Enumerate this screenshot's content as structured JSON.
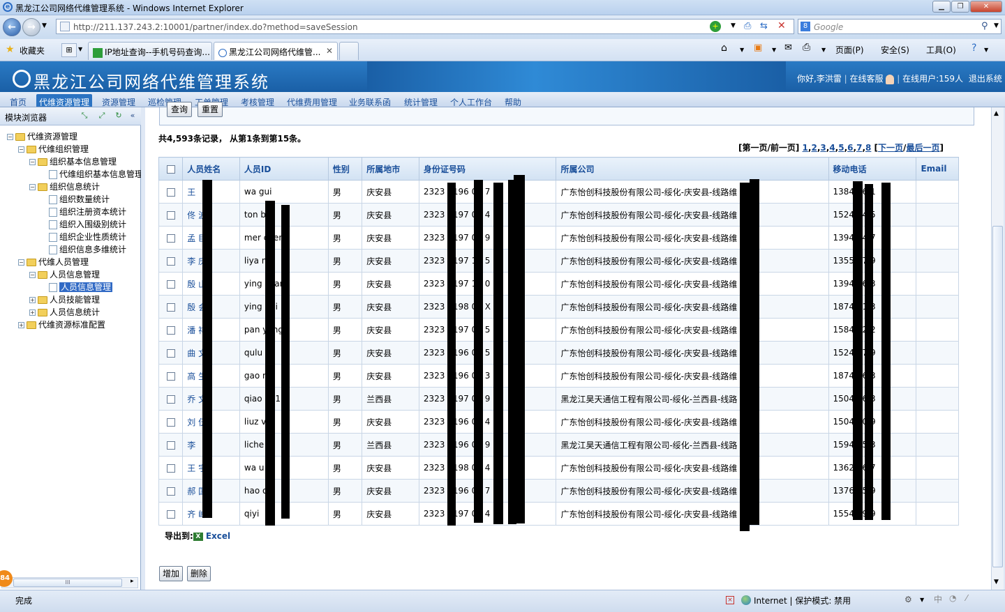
{
  "window": {
    "title": "黑龙江公司网络代维管理系统 - Windows Internet Explorer"
  },
  "browser": {
    "url": "http://211.137.243.2:10001/partner/index.do?method=saveSession",
    "search_placeholder": "Google",
    "favorites_label": "收藏夹",
    "tabs": [
      {
        "label": "IP地址查询--手机号码查询..."
      },
      {
        "label": "黑龙江公司网络代维管..."
      }
    ],
    "commands": {
      "page": "页面(P)",
      "safety": "安全(S)",
      "tools": "工具(O)"
    }
  },
  "app": {
    "brand": "黑龙江公司网络代维管理系统",
    "greeting": "你好,李洪雷",
    "online_service": "在线客服",
    "online_users": "在线用户:159人",
    "logout": "退出系统"
  },
  "menu": [
    "首页",
    "代维资源管理",
    "资源管理",
    "巡检管理",
    "工单管理",
    "考核管理",
    "代维费用管理",
    "业务联系函",
    "统计管理",
    "个人工作台",
    "帮助"
  ],
  "sidebar": {
    "title": "模块浏览器",
    "tree": [
      {
        "label": "代维资源管理"
      },
      {
        "label": "代维组织管理"
      },
      {
        "label": "组织基本信息管理"
      },
      {
        "label": "代维组织基本信息管理"
      },
      {
        "label": "组织信息统计"
      },
      {
        "label": "组织数量统计"
      },
      {
        "label": "组织注册资本统计"
      },
      {
        "label": "组织入围级别统计"
      },
      {
        "label": "组织企业性质统计"
      },
      {
        "label": "组织信息多维统计"
      },
      {
        "label": "代维人员管理"
      },
      {
        "label": "人员信息管理"
      },
      {
        "label": "人员信息管理"
      },
      {
        "label": "人员技能管理"
      },
      {
        "label": "人员信息统计"
      },
      {
        "label": "代维资源标准配置"
      }
    ]
  },
  "filter": {
    "query_label": "查询",
    "reset_label": "重置"
  },
  "summary": "共4,593条记录， 从第1条到第15条。",
  "pager": {
    "first_prev": "[第一页/前一页]",
    "pages": [
      "1",
      "2",
      "3",
      "4",
      "5",
      "6",
      "7",
      "8"
    ],
    "next": "下一页",
    "last": "最后一页"
  },
  "table": {
    "headers": [
      "人员姓名",
      "人员ID",
      "性别",
      "所属地市",
      "身份证号码",
      "所属公司",
      "移动电话",
      "Email"
    ],
    "rows": [
      {
        "name": "王",
        "id": "wa gui",
        "gender": "男",
        "city": "庆安县",
        "idno": "2323 0196 04 7",
        "company": "广东怡创科技股份有限公司-绥化-庆安县-线路维 组",
        "phone": "1384 96 1",
        "email": ""
      },
      {
        "name": "佟 波",
        "id": "ton bo",
        "gender": "男",
        "city": "庆安县",
        "idno": "2323 0197 01 4",
        "company": "广东怡创科技股份有限公司-绥化-庆安县-线路维 组",
        "phone": "1524 74 5",
        "email": ""
      },
      {
        "name": "孟 臣",
        "id": "mer chen",
        "gender": "男",
        "city": "庆安县",
        "idno": "2323 0197 01 9",
        "company": "广东怡创科技股份有限公司-绥化-庆安县-线路维 组",
        "phone": "1394 64 7",
        "email": ""
      },
      {
        "name": "李 庆",
        "id": "liya n",
        "gender": "男",
        "city": "庆安县",
        "idno": "2323 0197 11 5",
        "company": "广东怡创科技股份有限公司-绥化-庆安县-线路维 组",
        "phone": "1355 57 9",
        "email": ""
      },
      {
        "name": "殷 山",
        "id": "ying shan",
        "gender": "男",
        "city": "庆安县",
        "idno": "2323 0197 11 0",
        "company": "广东怡创科技股份有限公司-绥化-庆安县-线路维 组",
        "phone": "1394 86 3",
        "email": ""
      },
      {
        "name": "殷 会",
        "id": "ying hui",
        "gender": "男",
        "city": "庆安县",
        "idno": "2323 0198 04 X",
        "company": "广东怡创科技股份有限公司-绥化-庆安县-线路维 组",
        "phone": "1874 51 3",
        "email": ""
      },
      {
        "name": "潘 祥",
        "id": "pan yang",
        "gender": "男",
        "city": "庆安县",
        "idno": "2323 0197 04 5",
        "company": "广东怡创科技股份有限公司-绥化-庆安县-线路维 组",
        "phone": "1584 42 2",
        "email": ""
      },
      {
        "name": "曲 文",
        "id": "qulu",
        "gender": "男",
        "city": "庆安县",
        "idno": "2323 0196 03 5",
        "company": "广东怡创科技股份有限公司-绥化-庆安县-线路维 组",
        "phone": "1524 37 9",
        "email": ""
      },
      {
        "name": "高 生",
        "id": "gao ng",
        "gender": "男",
        "city": "庆安县",
        "idno": "2323 0196 05 3",
        "company": "广东怡创科技股份有限公司-绥化-庆安县-线路维 组",
        "phone": "1874 76 3",
        "email": ""
      },
      {
        "name": "乔 文",
        "id": "qiao en1",
        "gender": "男",
        "city": "兰西县",
        "idno": "2323 5197 05 9",
        "company": "黑龙江昊天通信工程有限公司-绥化-兰西县-线路 2组",
        "phone": "1504 56 3",
        "email": ""
      },
      {
        "name": "刘 伍",
        "id": "liuz vu",
        "gender": "男",
        "city": "庆安县",
        "idno": "2323 0196 03 4",
        "company": "广东怡创科技股份有限公司-绥化-庆安县-线路维 组",
        "phone": "1504 20 9",
        "email": ""
      },
      {
        "name": "李",
        "id": "liche",
        "gender": "男",
        "city": "兰西县",
        "idno": "2323 5196 01 9",
        "company": "黑龙江昊天通信工程有限公司-绥化-兰西县-线路 2组",
        "phone": "1594 05 3",
        "email": ""
      },
      {
        "name": "王 宇",
        "id": "wa u",
        "gender": "男",
        "city": "庆安县",
        "idno": "2323 0198 01 4",
        "company": "广东怡创科技股份有限公司-绥化-庆安县-线路维 组",
        "phone": "1362 86 7",
        "email": ""
      },
      {
        "name": "郝 国",
        "id": "hao o",
        "gender": "男",
        "city": "庆安县",
        "idno": "2323 0196 09 7",
        "company": "广东怡创科技股份有限公司-绥化-庆安县-线路维 组",
        "phone": "1376 05 9",
        "email": ""
      },
      {
        "name": "齐 峰",
        "id": "qiyi",
        "gender": "男",
        "city": "庆安县",
        "idno": "2323 0197 04 4",
        "company": "广东怡创科技股份有限公司-绥化-庆安县-线路维 组",
        "phone": "1554 49 9",
        "email": ""
      }
    ]
  },
  "export": {
    "label": "导出到:",
    "excel": "Excel"
  },
  "actions": {
    "add": "增加",
    "delete": "删除"
  },
  "statusbar": {
    "text": "完成",
    "zone": "Internet | 保护模式: 禁用",
    "badge": "84"
  }
}
